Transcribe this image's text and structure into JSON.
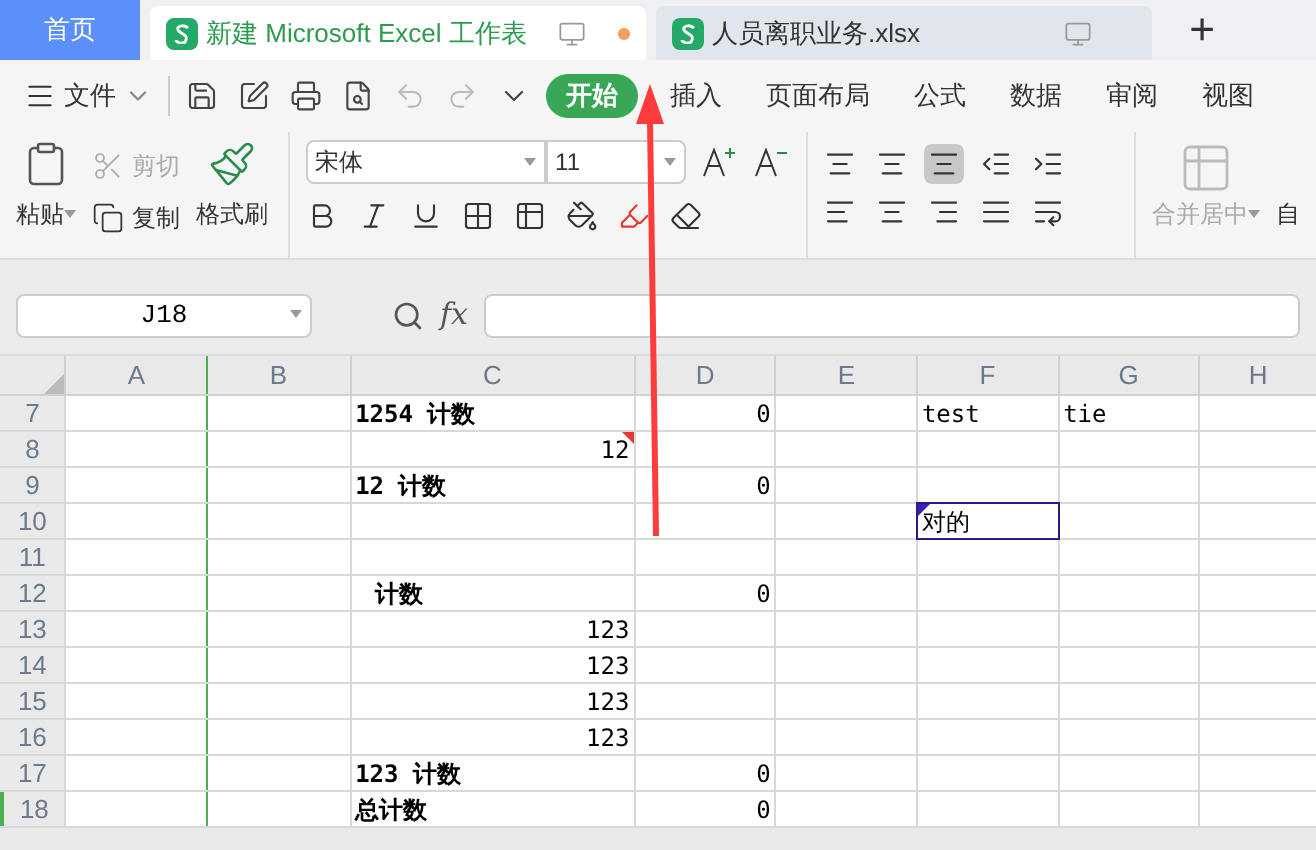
{
  "tabs": [
    {
      "label": "首页",
      "kind": "home",
      "selected": false,
      "unsaved": false
    },
    {
      "label": "新建 Microsoft Excel 工作表",
      "kind": "doc",
      "selected": true,
      "unsaved": true
    },
    {
      "label": "人员离职业务.xlsx",
      "kind": "doc",
      "selected": false,
      "unsaved": false
    }
  ],
  "new_tab": "+",
  "menu": {
    "file": "文件",
    "items": [
      {
        "label": "开始",
        "selected": true
      },
      {
        "label": "插入",
        "selected": false
      },
      {
        "label": "页面布局",
        "selected": false
      },
      {
        "label": "公式",
        "selected": false
      },
      {
        "label": "数据",
        "selected": false
      },
      {
        "label": "审阅",
        "selected": false
      },
      {
        "label": "视图",
        "selected": false
      }
    ]
  },
  "ribbon": {
    "paste": "粘贴",
    "cut": {
      "label": "剪切",
      "disabled": true
    },
    "copy": "复制",
    "format_painter": "格式刷",
    "font": "宋体",
    "size": "11",
    "merge": {
      "label": "合并居中",
      "disabled": true
    },
    "wrap": "自"
  },
  "formula_bar": {
    "name_box": "J18",
    "fx": "fx"
  },
  "grid": {
    "columns": [
      "A",
      "B",
      "C",
      "D",
      "E",
      "F",
      "G",
      "H"
    ],
    "rows": [
      {
        "number": "7",
        "selected": false,
        "cells": {
          "C": {
            "text": "1254 计数",
            "kind": "label",
            "comment": false,
            "selected": false
          },
          "D": {
            "text": "0",
            "kind": "number",
            "comment": false,
            "selected": false
          },
          "F": {
            "text": "test",
            "kind": "text",
            "comment": false,
            "selected": false
          },
          "G": {
            "text": "tie",
            "kind": "text",
            "comment": false,
            "selected": false
          }
        }
      },
      {
        "number": "8",
        "selected": false,
        "cells": {
          "C": {
            "text": "12",
            "kind": "number",
            "comment": true,
            "selected": false
          }
        }
      },
      {
        "number": "9",
        "selected": false,
        "cells": {
          "C": {
            "text": "12 计数",
            "kind": "label",
            "comment": false,
            "selected": false
          },
          "D": {
            "text": "0",
            "kind": "number",
            "comment": false,
            "selected": false
          }
        }
      },
      {
        "number": "10",
        "selected": false,
        "cells": {
          "F": {
            "text": "对的",
            "kind": "text",
            "comment": false,
            "selected": true
          }
        }
      },
      {
        "number": "11",
        "selected": false,
        "cells": {}
      },
      {
        "number": "12",
        "selected": false,
        "cells": {
          "C": {
            "text": "计数",
            "kind": "indent",
            "comment": false,
            "selected": false
          },
          "D": {
            "text": "0",
            "kind": "number",
            "comment": false,
            "selected": false
          }
        }
      },
      {
        "number": "13",
        "selected": false,
        "cells": {
          "C": {
            "text": "123",
            "kind": "number",
            "comment": false,
            "selected": false
          }
        }
      },
      {
        "number": "14",
        "selected": false,
        "cells": {
          "C": {
            "text": "123",
            "kind": "number",
            "comment": false,
            "selected": false
          }
        }
      },
      {
        "number": "15",
        "selected": false,
        "cells": {
          "C": {
            "text": "123",
            "kind": "number",
            "comment": false,
            "selected": false
          }
        }
      },
      {
        "number": "16",
        "selected": false,
        "cells": {
          "C": {
            "text": "123",
            "kind": "number",
            "comment": false,
            "selected": false
          }
        }
      },
      {
        "number": "17",
        "selected": false,
        "cells": {
          "C": {
            "text": "123 计数",
            "kind": "label",
            "comment": false,
            "selected": false
          },
          "D": {
            "text": "0",
            "kind": "number",
            "comment": false,
            "selected": false
          }
        }
      },
      {
        "number": "18",
        "selected": true,
        "cells": {
          "C": {
            "text": "总计数",
            "kind": "label",
            "comment": false,
            "selected": false
          },
          "D": {
            "text": "0",
            "kind": "number",
            "comment": false,
            "selected": false
          }
        }
      }
    ]
  }
}
